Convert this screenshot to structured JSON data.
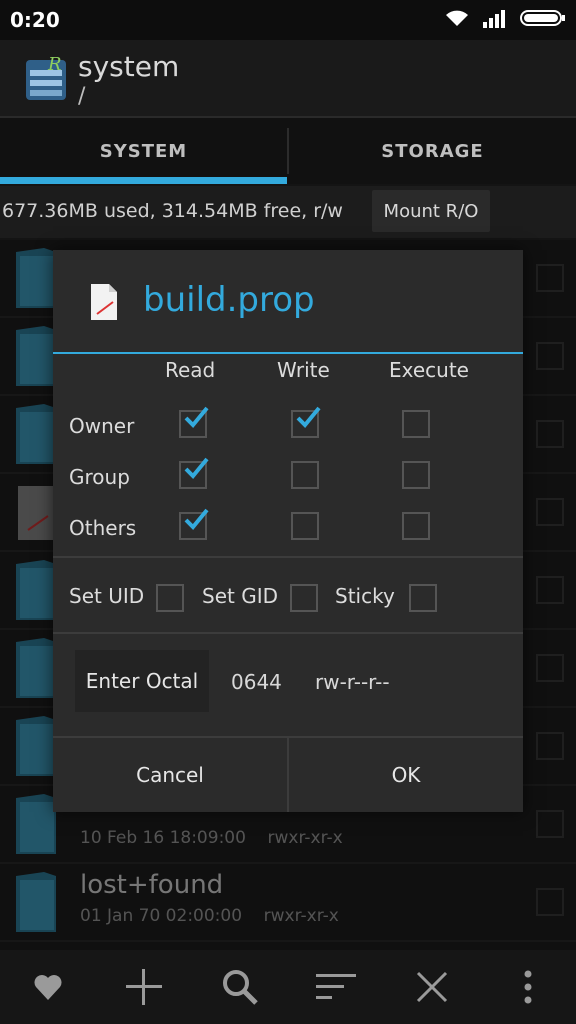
{
  "status_bar": {
    "time": "0:20"
  },
  "app_bar": {
    "title": "system",
    "path": "/"
  },
  "tabs": [
    {
      "label": "SYSTEM",
      "active": true
    },
    {
      "label": "STORAGE",
      "active": false
    }
  ],
  "storage": {
    "info": "677.36MB used, 314.54MB free, r/w",
    "mount_button": "Mount R/O"
  },
  "file_list": [
    {
      "name": "",
      "meta": ""
    },
    {
      "name": "",
      "meta": ""
    },
    {
      "name": "",
      "meta": ""
    },
    {
      "name": "",
      "meta": ""
    },
    {
      "name": "",
      "meta": ""
    },
    {
      "name": "",
      "meta": ""
    },
    {
      "name": "",
      "meta": ""
    },
    {
      "name": "",
      "meta": "10 Feb 16 18:09:00    rwxr-xr-x"
    },
    {
      "name": "lost+found",
      "meta": "01 Jan 70 02:00:00    rwxr-xr-x"
    }
  ],
  "dialog": {
    "title": "build.prop",
    "columns": [
      "Read",
      "Write",
      "Execute"
    ],
    "rows": [
      {
        "label": "Owner",
        "read": true,
        "write": true,
        "execute": false
      },
      {
        "label": "Group",
        "read": true,
        "write": false,
        "execute": false
      },
      {
        "label": "Others",
        "read": true,
        "write": false,
        "execute": false
      }
    ],
    "special": [
      {
        "label": "Set UID",
        "checked": false
      },
      {
        "label": "Set GID",
        "checked": false
      },
      {
        "label": "Sticky",
        "checked": false
      }
    ],
    "octal_button": "Enter Octal",
    "octal_value": "0644",
    "perm_string": "rw-r--r--",
    "cancel": "Cancel",
    "ok": "OK"
  },
  "bottom_bar": [
    "heart-icon",
    "add-icon",
    "search-icon",
    "sort-icon",
    "close-icon",
    "more-vert-icon"
  ],
  "colors": {
    "accent": "#33aadd",
    "background": "#1e1e1e",
    "dialog": "#2b2b2b"
  }
}
